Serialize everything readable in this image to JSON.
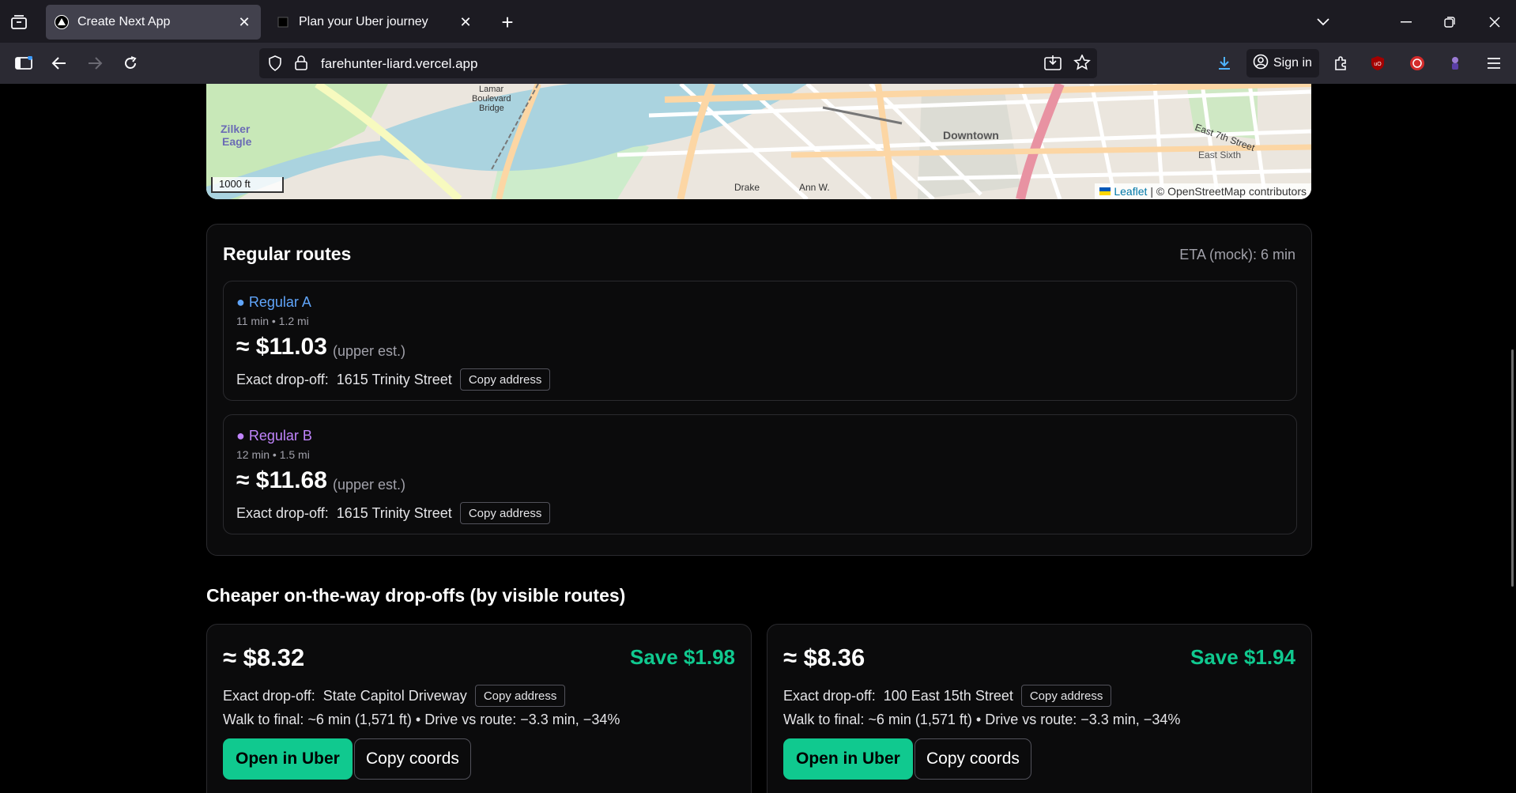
{
  "browser": {
    "tabs": [
      {
        "title": "Create Next App",
        "active": true
      },
      {
        "title": "Plan your Uber journey",
        "active": false
      }
    ],
    "url": "farehunter-liard.vercel.app",
    "signin_label": "Sign in",
    "icons": [
      "tab-list-icon",
      "close-icon",
      "new-tab-icon",
      "list-all-tabs-icon",
      "minimize-icon",
      "restore-icon",
      "window-close-icon",
      "sidebar-icon",
      "back-icon",
      "forward-icon",
      "reload-icon",
      "shield-icon",
      "lock-icon",
      "install-icon",
      "bookmark-star-icon",
      "download-icon",
      "account-icon",
      "extensions-icon",
      "ublock-icon",
      "extension-icon",
      "menu-icon"
    ]
  },
  "map": {
    "scale_label": "1000 ft",
    "attribution_link": "Leaflet",
    "attribution_text": "| © OpenStreetMap contributors",
    "labels": [
      "Zilker Eagle",
      "Lamar Boulevard Bridge",
      "Downtown",
      "East Sixth",
      "East 7th Street",
      "Drake",
      "Ann W."
    ]
  },
  "routes": {
    "title": "Regular routes",
    "eta": "ETA (mock): 6 min",
    "items": [
      {
        "name": "● Regular A",
        "meta": "11 min • 1.2 mi",
        "price": "≈ $11.03",
        "est": "(upper est.)",
        "drop_label": "Exact drop-off:",
        "drop_address": "1615 Trinity Street",
        "copy_label": "Copy address",
        "color": "#60a5fa"
      },
      {
        "name": "● Regular B",
        "meta": "12 min • 1.5 mi",
        "price": "≈ $11.68",
        "est": "(upper est.)",
        "drop_label": "Exact drop-off:",
        "drop_address": "1615 Trinity Street",
        "copy_label": "Copy address",
        "color": "#c084fc"
      }
    ]
  },
  "cheaper": {
    "title": "Cheaper on-the-way drop-offs (by visible routes)",
    "offers": [
      {
        "price": "≈ $8.32",
        "save": "Save $1.98",
        "drop_label": "Exact drop-off:",
        "drop_address": "State Capitol Driveway",
        "copy_label": "Copy address",
        "walk": "Walk to final: ~6 min (1,571 ft) • Drive vs route: −3.3 min, −34%",
        "open_label": "Open in Uber",
        "coords_label": "Copy coords"
      },
      {
        "price": "≈ $8.36",
        "save": "Save $1.94",
        "drop_label": "Exact drop-off:",
        "drop_address": "100 East 15th Street",
        "copy_label": "Copy address",
        "walk": "Walk to final: ~6 min (1,571 ft) • Drive vs route: −3.3 min, −34%",
        "open_label": "Open in Uber",
        "coords_label": "Copy coords"
      }
    ]
  },
  "colors": {
    "accent": "#10c98f",
    "regular_a": "#60a5fa",
    "regular_b": "#c084fc"
  }
}
